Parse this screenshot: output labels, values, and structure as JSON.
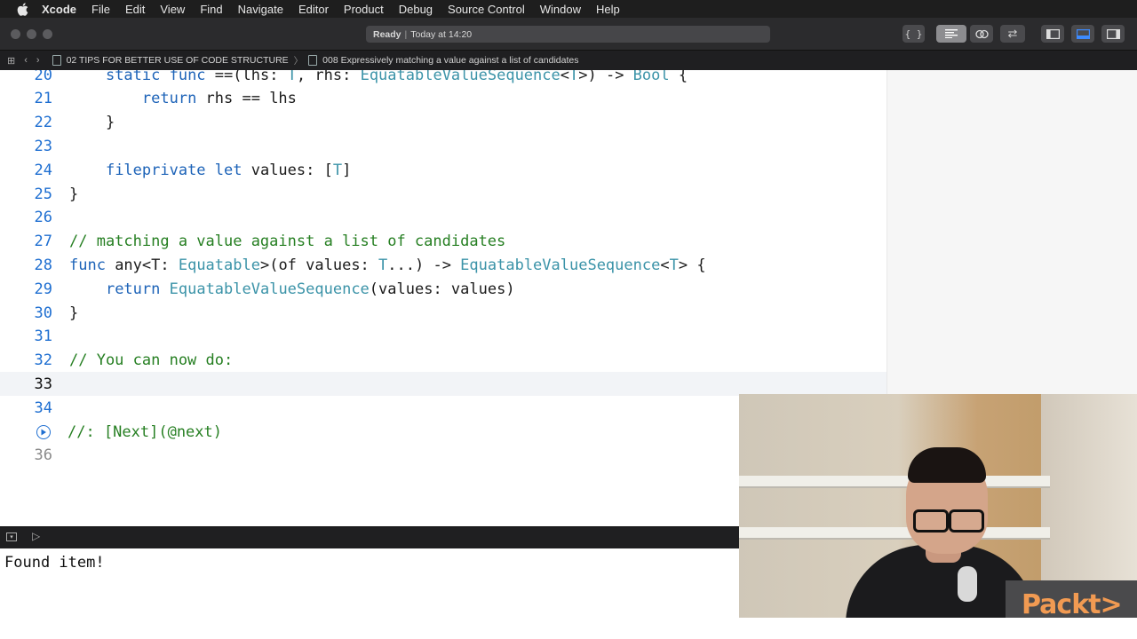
{
  "menubar": {
    "app": "Xcode",
    "items": [
      "File",
      "Edit",
      "View",
      "Find",
      "Navigate",
      "Editor",
      "Product",
      "Debug",
      "Source Control",
      "Window",
      "Help"
    ]
  },
  "toolbar": {
    "activity_status": "Ready",
    "activity_time": "Today at 14:20",
    "buttons": [
      "library-button",
      "standard-editor-button",
      "assistant-editor-button",
      "version-editor-button",
      "navigator-toggle",
      "debug-area-toggle",
      "inspector-toggle"
    ]
  },
  "jumpbar": {
    "crumb1": "02 TIPS FOR BETTER USE OF CODE STRUCTURE",
    "crumb2": "008 Expressively matching a value against a list of candidates"
  },
  "editor": {
    "lines": [
      {
        "n": "20",
        "tokens": [
          [
            "    ",
            ""
          ],
          [
            "static func",
            "kw"
          ],
          [
            " ==(lhs: ",
            ""
          ],
          [
            "T",
            "ty"
          ],
          [
            ", rhs: ",
            ""
          ],
          [
            "EquatableValueSequence",
            "ty"
          ],
          [
            "<",
            ""
          ],
          [
            "T",
            "ty"
          ],
          [
            ">) -> ",
            ""
          ],
          [
            "Bool",
            "ty"
          ],
          [
            " {",
            ""
          ]
        ]
      },
      {
        "n": "21",
        "tokens": [
          [
            "        ",
            ""
          ],
          [
            "return",
            "kw"
          ],
          [
            " rhs == lhs",
            ""
          ]
        ]
      },
      {
        "n": "22",
        "tokens": [
          [
            "    }",
            ""
          ]
        ]
      },
      {
        "n": "23",
        "tokens": []
      },
      {
        "n": "24",
        "tokens": [
          [
            "    ",
            ""
          ],
          [
            "fileprivate let",
            "kw"
          ],
          [
            " values: [",
            ""
          ],
          [
            "T",
            "ty"
          ],
          [
            "]",
            ""
          ]
        ]
      },
      {
        "n": "25",
        "tokens": [
          [
            "}",
            ""
          ]
        ]
      },
      {
        "n": "26",
        "tokens": []
      },
      {
        "n": "27",
        "tokens": [
          [
            "// matching a value against a list of candidates",
            "cm"
          ]
        ]
      },
      {
        "n": "28",
        "tokens": [
          [
            "func",
            "kw"
          ],
          [
            " any<T: ",
            ""
          ],
          [
            "Equatable",
            "ty"
          ],
          [
            ">(of values: ",
            ""
          ],
          [
            "T",
            "ty"
          ],
          [
            "...) -> ",
            ""
          ],
          [
            "EquatableValueSequence",
            "ty"
          ],
          [
            "<",
            ""
          ],
          [
            "T",
            "ty"
          ],
          [
            "> {",
            ""
          ]
        ]
      },
      {
        "n": "29",
        "tokens": [
          [
            "    ",
            ""
          ],
          [
            "return",
            "kw"
          ],
          [
            " ",
            ""
          ],
          [
            "EquatableValueSequence",
            "ty"
          ],
          [
            "(values: values)",
            ""
          ]
        ]
      },
      {
        "n": "30",
        "tokens": [
          [
            "}",
            ""
          ]
        ]
      },
      {
        "n": "31",
        "tokens": []
      },
      {
        "n": "32",
        "tokens": [
          [
            "// You can now do:",
            "cm"
          ]
        ]
      },
      {
        "n": "33",
        "tokens": [],
        "current": true
      },
      {
        "n": "34",
        "tokens": []
      },
      {
        "n": "35",
        "tokens": [
          [
            "//: [Next](@next)",
            "cm"
          ]
        ],
        "run": true
      },
      {
        "n": "36",
        "tokens": [],
        "dim": true
      }
    ]
  },
  "console": {
    "output": "Found item!"
  },
  "overlay": {
    "logo": "Packt>"
  }
}
